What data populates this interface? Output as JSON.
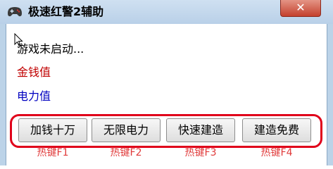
{
  "window": {
    "title": "极速红警2辅助",
    "close_label": "✕"
  },
  "icons": {
    "app": "gamepad-icon",
    "cursor": "mouse-pointer-icon"
  },
  "status": {
    "text": "游戏未启动..."
  },
  "labels": {
    "money": "金钱值",
    "power": "电力值"
  },
  "buttons": [
    {
      "label": "加钱十万",
      "hotkey": "热键F1"
    },
    {
      "label": "无限电力",
      "hotkey": "热键F2"
    },
    {
      "label": "快速建造",
      "hotkey": "热键F3"
    },
    {
      "label": "建造免费",
      "hotkey": "热键F4"
    }
  ],
  "colors": {
    "money_text": "#c00000",
    "power_text": "#0000c0",
    "highlight_border": "#e0001a",
    "hotkey_text": "#e03a3a",
    "close_button": "#c4402d"
  }
}
